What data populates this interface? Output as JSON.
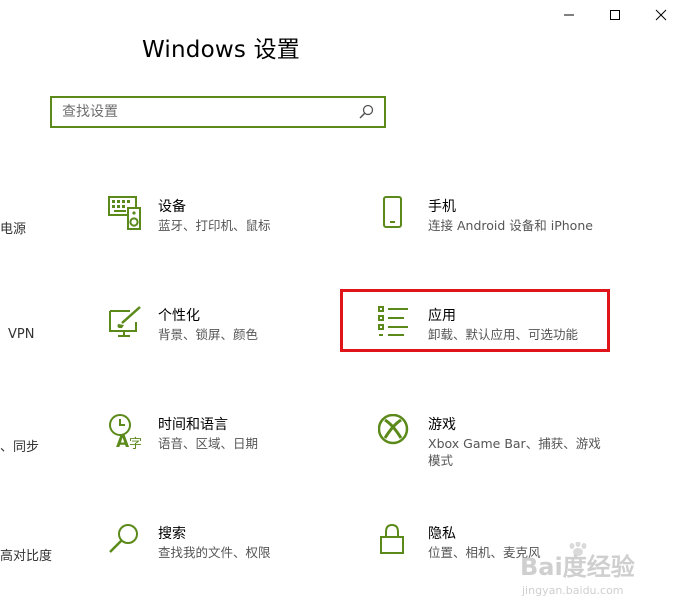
{
  "window_controls": {
    "minimize": "minimize",
    "maximize": "maximize",
    "close": "close"
  },
  "title": "Windows 设置",
  "search": {
    "placeholder": "查找设置"
  },
  "edge_labels": [
    "电源",
    "VPN",
    "、同步",
    "高对比度"
  ],
  "tiles": [
    {
      "title": "设备",
      "desc": "蓝牙、打印机、鼠标",
      "icon": "keyboard-speaker-icon"
    },
    {
      "title": "手机",
      "desc": "连接 Android 设备和 iPhone",
      "icon": "phone-icon"
    },
    {
      "title": "个性化",
      "desc": "背景、锁屏、颜色",
      "icon": "paintbrush-icon"
    },
    {
      "title": "应用",
      "desc": "卸载、默认应用、可选功能",
      "icon": "apps-list-icon"
    },
    {
      "title": "时间和语言",
      "desc": "语音、区域、日期",
      "icon": "time-language-icon"
    },
    {
      "title": "游戏",
      "desc": "Xbox Game Bar、捕获、游戏模式",
      "icon": "xbox-icon"
    },
    {
      "title": "搜索",
      "desc": "查找我的文件、权限",
      "icon": "search-icon"
    },
    {
      "title": "隐私",
      "desc": "位置、相机、麦克风",
      "icon": "lock-icon"
    }
  ],
  "watermark": {
    "text": "Bai度经验",
    "subtext": "jingyan.baidu.com"
  },
  "colors": {
    "accent": "#5b8a1a",
    "highlight": "#e0151a"
  }
}
